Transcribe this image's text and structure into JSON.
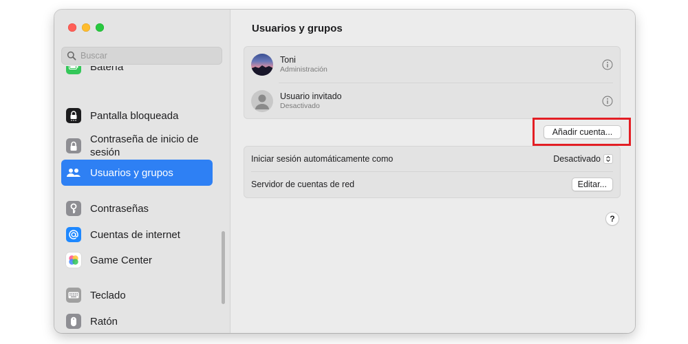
{
  "window": {
    "title": "Usuarios y grupos"
  },
  "search": {
    "placeholder": "Buscar"
  },
  "sidebar": {
    "items": [
      {
        "label": "Batería",
        "icon": "battery-icon",
        "color": "#34c759"
      },
      {
        "label": "Pantalla bloqueada",
        "icon": "lock-screen-icon",
        "color": "#1c1c1e"
      },
      {
        "label": "Contraseña de inicio de sesión",
        "icon": "padlock-icon",
        "color": "#8e8e93"
      },
      {
        "label": "Usuarios y grupos",
        "icon": "users-icon",
        "color": "#2e80f4",
        "selected": true
      },
      {
        "label": "Contraseñas",
        "icon": "key-icon",
        "color": "#8e8e93"
      },
      {
        "label": "Cuentas de internet",
        "icon": "at-sign-icon",
        "color": "#1e88ff"
      },
      {
        "label": "Game Center",
        "icon": "game-center-icon",
        "color": "#ffffff"
      },
      {
        "label": "Teclado",
        "icon": "keyboard-icon",
        "color": "#a0a0a0"
      },
      {
        "label": "Ratón",
        "icon": "mouse-icon",
        "color": "#8e8e93"
      }
    ]
  },
  "users": [
    {
      "name": "Toni",
      "role": "Administración",
      "avatar": "landscape-avatar"
    },
    {
      "name": "Usuario invitado",
      "role": "Desactivado",
      "avatar": "guest-avatar"
    }
  ],
  "actions": {
    "add_account": "Añadir cuenta..."
  },
  "settings": [
    {
      "label": "Iniciar sesión automáticamente como",
      "value": "Desactivado",
      "control": "popup"
    },
    {
      "label": "Servidor de cuentas de red",
      "value": "Editar...",
      "control": "button"
    }
  ],
  "help_label": "?",
  "colors": {
    "accent": "#2e80f4",
    "highlight_box": "#e31e24"
  }
}
